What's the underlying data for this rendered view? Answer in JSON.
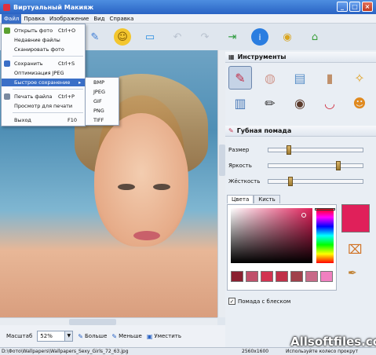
{
  "window": {
    "title": "Виртуальный Макияж"
  },
  "menubar": {
    "items": [
      "Файл",
      "Правка",
      "Изображение",
      "Вид",
      "Справка"
    ]
  },
  "file_menu": {
    "items": [
      {
        "label": "Открыть фото",
        "shortcut": "Ctrl+O"
      },
      {
        "label": "Недавние файлы",
        "shortcut": ""
      },
      {
        "label": "Сканировать фото",
        "shortcut": ""
      },
      {
        "label": "Сохранить",
        "shortcut": "Ctrl+S"
      },
      {
        "label": "Оптимизация JPEG",
        "shortcut": ""
      },
      {
        "label": "Быстрое сохранение",
        "shortcut": "▸"
      },
      {
        "label": "Печать файла",
        "shortcut": "Ctrl+P"
      },
      {
        "label": "Просмотр для печати",
        "shortcut": ""
      },
      {
        "label": "Выход",
        "shortcut": "F10"
      }
    ]
  },
  "quick_save_submenu": {
    "items": [
      "BMP",
      "JPEG",
      "GIF",
      "PNG",
      "TIFF"
    ]
  },
  "zoom": {
    "label": "Масштаб",
    "value": "52%",
    "bigger": "Больше",
    "smaller": "Меньше",
    "fit": "Уместить"
  },
  "status": {
    "path": "D:\\Фото\\Wallpapers\\Wallpapers_Sexy_Girls_72_63.jpg",
    "resolution": "2560x1600",
    "hint": "Используйте колесо прокрут"
  },
  "panel": {
    "tools_title": "Инструменты",
    "section_title": "Губная помада",
    "sliders": [
      {
        "label": "Размер",
        "value": 0.2
      },
      {
        "label": "Яркость",
        "value": 0.75
      },
      {
        "label": "Жёсткость",
        "value": 0.22
      }
    ],
    "tabs": [
      "Цвета",
      "Кисть"
    ],
    "gloss_label": "Помада с блеском",
    "gloss_checked": true
  },
  "colors": {
    "selected": "#e0205a",
    "swatches": [
      "#8a2030",
      "#c0506a",
      "#d23350",
      "#c03048",
      "#a0404a",
      "#c86a88",
      "#f080c0"
    ]
  },
  "watermark": "Allsoftfiles.com"
}
